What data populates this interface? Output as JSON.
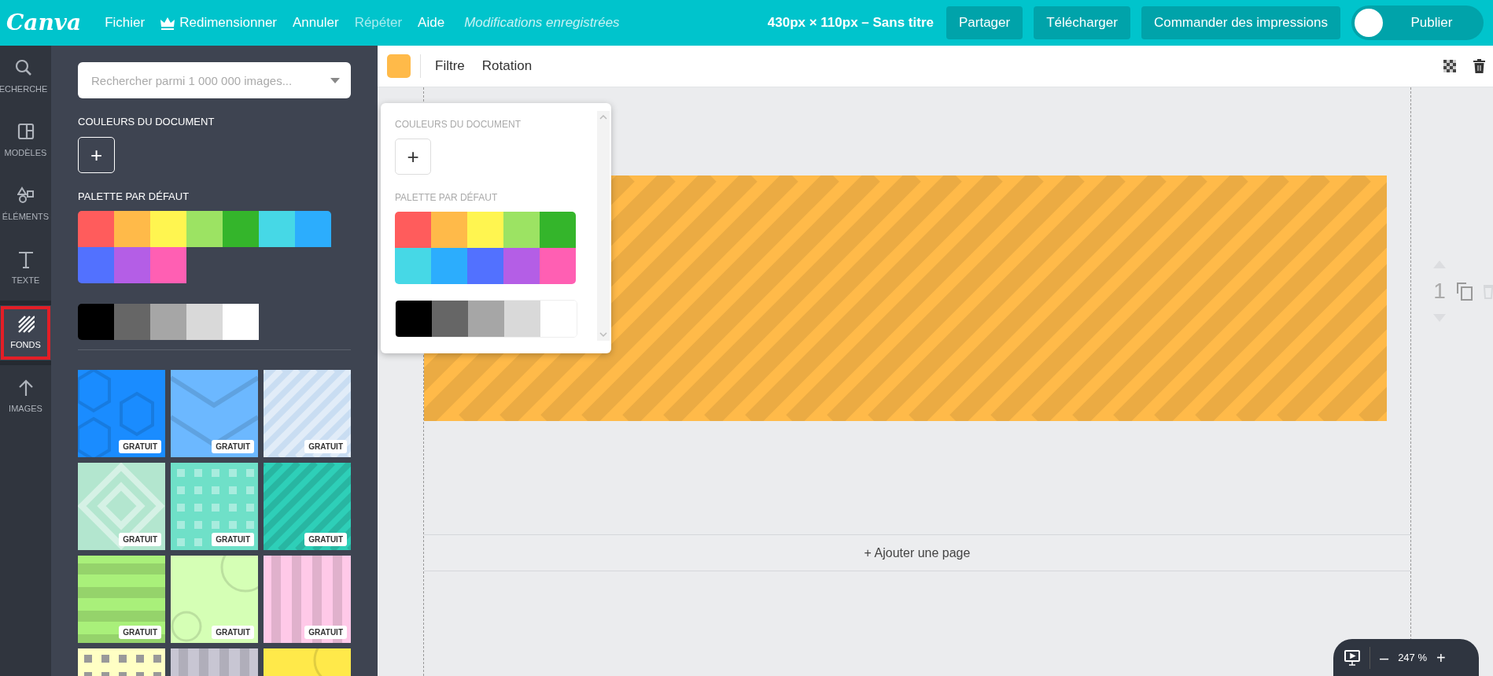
{
  "topbar": {
    "logo": "Canva",
    "menu": [
      {
        "label": "Fichier",
        "kind": "plain",
        "disabled": false
      },
      {
        "label": "Redimensionner",
        "kind": "crown",
        "disabled": false
      },
      {
        "label": "Annuler",
        "kind": "plain",
        "disabled": false
      },
      {
        "label": "Répéter",
        "kind": "plain",
        "disabled": true
      },
      {
        "label": "Aide",
        "kind": "plain",
        "disabled": false
      }
    ],
    "status": "Modifications enregistrées",
    "doc_title": "430px × 110px – Sans titre",
    "buttons": [
      "Partager",
      "Télécharger",
      "Commander des impressions"
    ],
    "publish": {
      "label": "Publier",
      "on": false
    }
  },
  "rail": [
    {
      "label": "ECHERCHE",
      "kind": "search",
      "selected": false
    },
    {
      "label": "MODÈLES",
      "kind": "layout",
      "selected": false
    },
    {
      "label": "ÉLÉMENTS",
      "kind": "shapes",
      "selected": false
    },
    {
      "label": "TEXTE",
      "kind": "text",
      "selected": false
    },
    {
      "label": "FONDS",
      "kind": "stripes",
      "selected": true
    },
    {
      "label": "IMAGES",
      "kind": "upload",
      "selected": false
    }
  ],
  "panel": {
    "search": {
      "placeholder": "Rechercher parmi 1 000 000 images..."
    },
    "doc_colors_title": "COULEURS DU DOCUMENT",
    "add_symbol": "+",
    "palette_title": "PALETTE PAR DÉFAUT",
    "palette": [
      {
        "color": "#ff5c5c"
      },
      {
        "color": "#ffba49"
      },
      {
        "color": "#fff550"
      },
      {
        "color": "#9ce363"
      },
      {
        "color": "#34b52b"
      },
      {
        "color": "#46d8e6"
      },
      {
        "color": "#2cadfd"
      },
      {
        "color": "#5271ff"
      },
      {
        "color": "#b45ee6"
      },
      {
        "color": "#ff5fb3"
      }
    ],
    "grays": [
      {
        "color": "#000000"
      },
      {
        "color": "#666666"
      },
      {
        "color": "#a6a6a6"
      },
      {
        "color": "#d9d9d9"
      },
      {
        "color": "#ffffff"
      }
    ],
    "backgrounds": [
      {
        "kind": "hexagons",
        "color": "#1a8cff",
        "badge": "GRATUIT"
      },
      {
        "kind": "chevrons",
        "color": "#6cb8ff",
        "badge": "GRATUIT"
      },
      {
        "kind": "stripes",
        "color": "#c9ddf2",
        "badge": "GRATUIT"
      },
      {
        "kind": "diamonds",
        "color": "#b3e6cf",
        "badge": "GRATUIT"
      },
      {
        "kind": "dots",
        "color": "#6fe0c8",
        "badge": "GRATUIT"
      },
      {
        "kind": "stripes",
        "color": "#2ecfb8",
        "badge": "GRATUIT"
      },
      {
        "kind": "bars",
        "color": "#a9f07a",
        "badge": "GRATUIT"
      },
      {
        "kind": "circles",
        "color": "#d5ffb5",
        "badge": "GRATUIT"
      },
      {
        "kind": "columns",
        "color": "#ffc9e8",
        "badge": "GRATUIT"
      },
      {
        "kind": "dots",
        "color": "#ffffc4"
      },
      {
        "kind": "columns",
        "color": "#c8c6d3"
      },
      {
        "kind": "circles",
        "color": "#ffe94a"
      }
    ]
  },
  "toolbar": {
    "color": "#ffba49",
    "items": [
      "Filtre",
      "Rotation"
    ]
  },
  "popup": {
    "doc_colors_title": "COULEURS DU DOCUMENT",
    "add_symbol": "+",
    "palette_title": "PALETTE PAR DÉFAUT",
    "palette": [
      {
        "color": "#ff5c5c"
      },
      {
        "color": "#ffba49"
      },
      {
        "color": "#fff550"
      },
      {
        "color": "#9ce363"
      },
      {
        "color": "#34b52b"
      },
      {
        "color": "#46d8e6"
      },
      {
        "color": "#2cadfd"
      },
      {
        "color": "#5271ff"
      },
      {
        "color": "#b45ee6"
      },
      {
        "color": "#ff5fb3"
      }
    ],
    "grays": [
      {
        "color": "#000000"
      },
      {
        "color": "#666666"
      },
      {
        "color": "#a6a6a6"
      },
      {
        "color": "#d9d9d9"
      },
      {
        "color": "#ffffff"
      }
    ]
  },
  "page": {
    "number": "1",
    "add_page": "+ Ajouter une page"
  },
  "zoom": {
    "value": "247 %",
    "minus": "–",
    "plus": "+"
  }
}
